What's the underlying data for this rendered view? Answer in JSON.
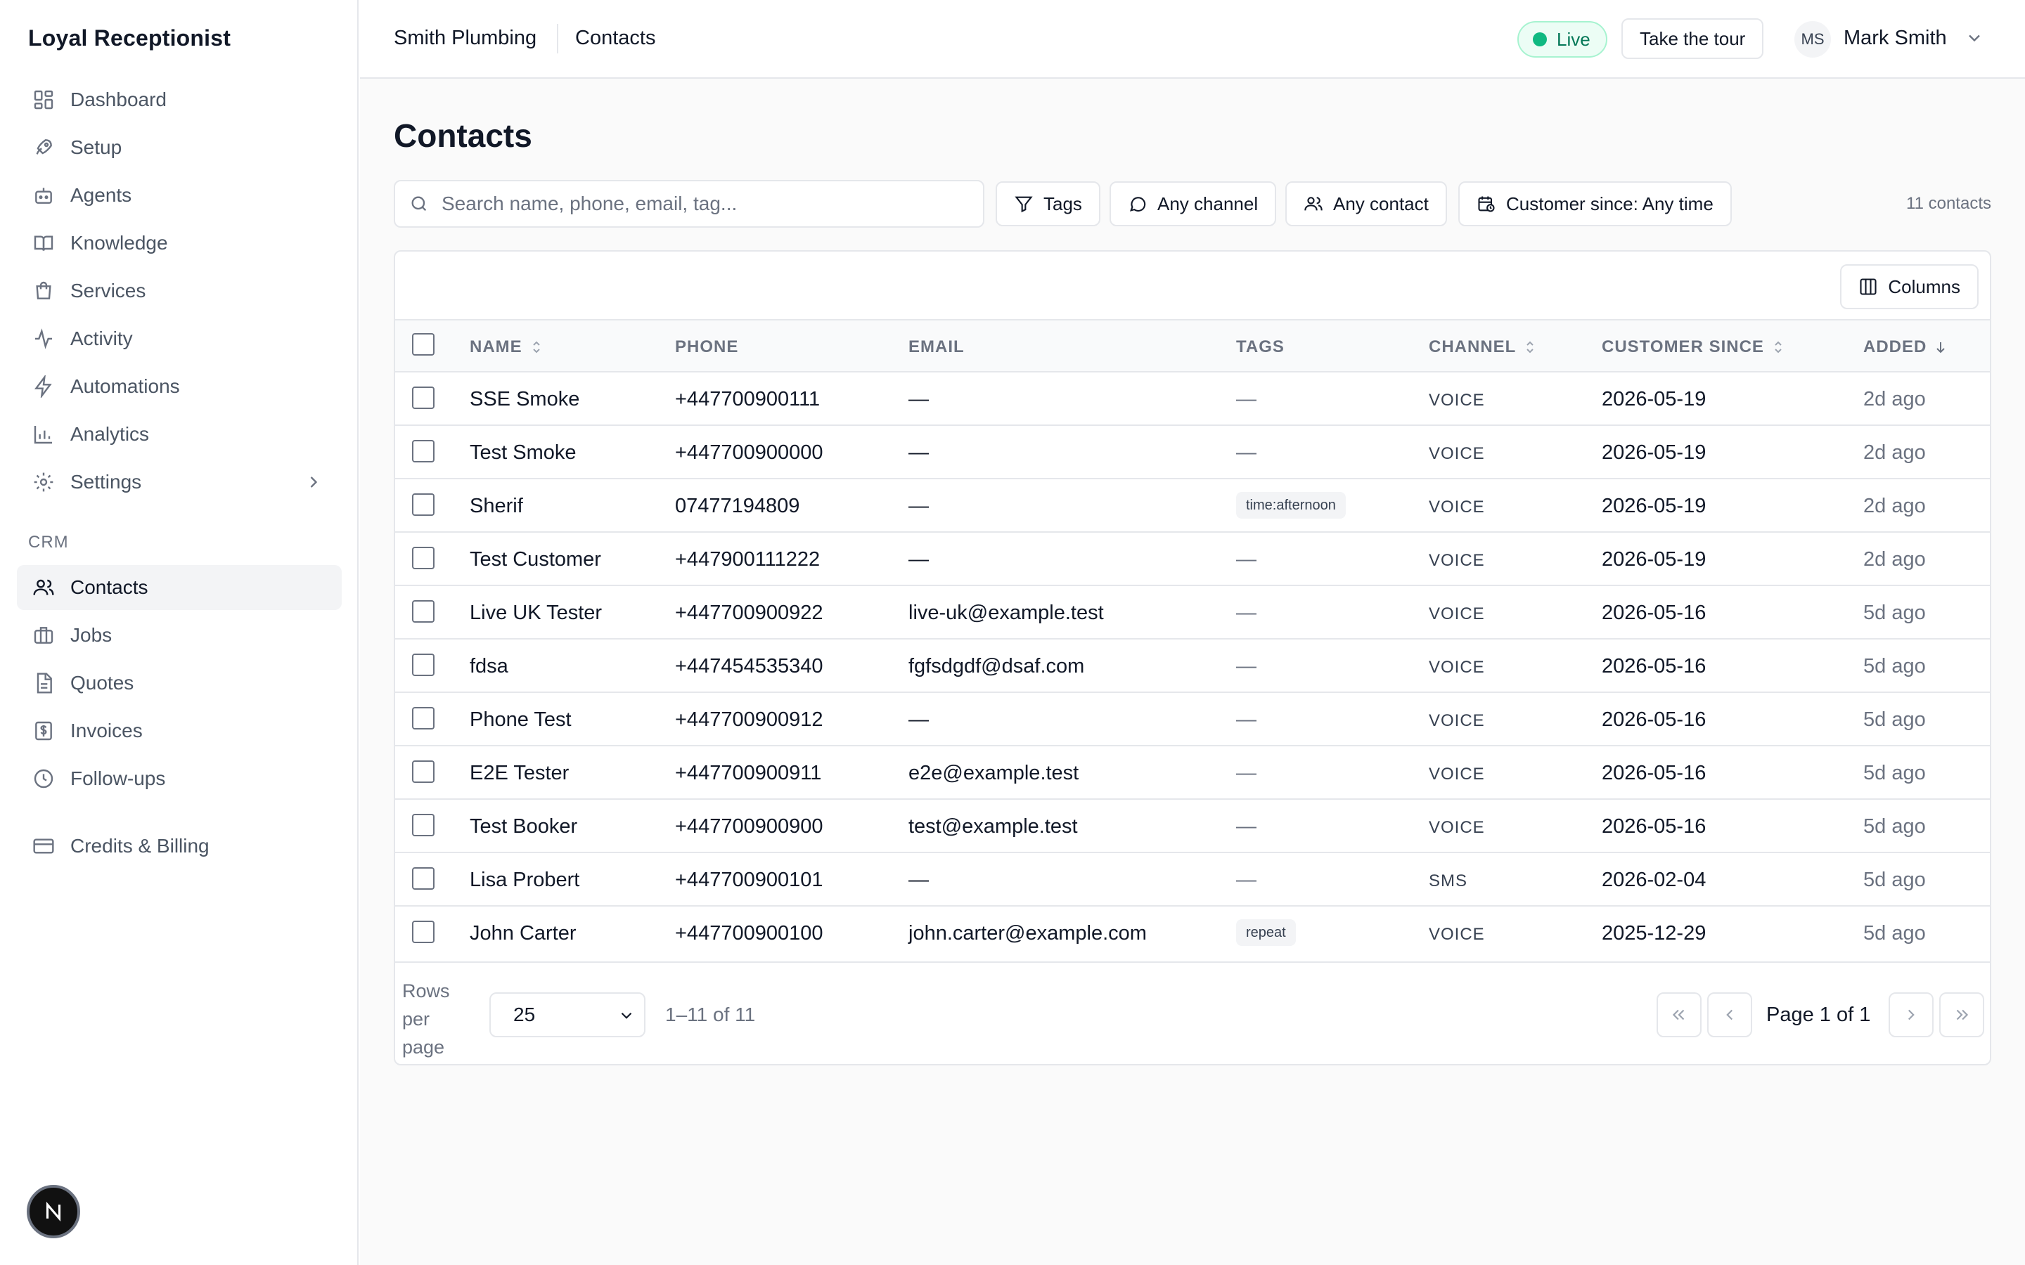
{
  "app": {
    "brand": "Loyal Receptionist"
  },
  "sidebar": {
    "items": [
      {
        "label": "Dashboard",
        "icon": "dashboard-icon"
      },
      {
        "label": "Setup",
        "icon": "rocket-icon"
      },
      {
        "label": "Agents",
        "icon": "bot-icon"
      },
      {
        "label": "Knowledge",
        "icon": "book-icon"
      },
      {
        "label": "Services",
        "icon": "shopping-bag-icon"
      },
      {
        "label": "Activity",
        "icon": "activity-icon"
      },
      {
        "label": "Automations",
        "icon": "lightning-icon"
      },
      {
        "label": "Analytics",
        "icon": "bar-chart-icon"
      },
      {
        "label": "Settings",
        "icon": "gear-icon"
      }
    ],
    "crm_section": "CRM",
    "crm_items": [
      {
        "label": "Contacts",
        "icon": "users-icon",
        "active": true
      },
      {
        "label": "Jobs",
        "icon": "briefcase-icon"
      },
      {
        "label": "Quotes",
        "icon": "file-icon"
      },
      {
        "label": "Invoices",
        "icon": "receipt-icon"
      },
      {
        "label": "Follow-ups",
        "icon": "clock-icon"
      }
    ],
    "billing_item": {
      "label": "Credits & Billing",
      "icon": "credit-card-icon"
    }
  },
  "topbar": {
    "breadcrumb_business": "Smith Plumbing",
    "breadcrumb_page": "Contacts",
    "live_label": "Live",
    "tour_label": "Take the tour",
    "user_initials": "MS",
    "user_name": "Mark Smith"
  },
  "page": {
    "title": "Contacts",
    "search_placeholder": "Search name, phone, email, tag...",
    "filters": {
      "tags": "Tags",
      "channel": "Any channel",
      "contact": "Any contact",
      "customer_since": "Customer since: Any time"
    },
    "count": "11 contacts",
    "columns_label": "Columns"
  },
  "table": {
    "headers": {
      "name": "NAME",
      "phone": "PHONE",
      "email": "EMAIL",
      "tags": "TAGS",
      "channel": "CHANNEL",
      "customer_since": "CUSTOMER SINCE",
      "added": "ADDED"
    },
    "rows": [
      {
        "name": "SSE Smoke",
        "phone": "+447700900111",
        "email": "—",
        "tags": "—",
        "tag_chip": false,
        "channel": "VOICE",
        "since": "2026-05-19",
        "added": "2d ago"
      },
      {
        "name": "Test Smoke",
        "phone": "+447700900000",
        "email": "—",
        "tags": "—",
        "tag_chip": false,
        "channel": "VOICE",
        "since": "2026-05-19",
        "added": "2d ago"
      },
      {
        "name": "Sherif",
        "phone": "07477194809",
        "email": "—",
        "tags": "time:afternoon",
        "tag_chip": true,
        "channel": "VOICE",
        "since": "2026-05-19",
        "added": "2d ago"
      },
      {
        "name": "Test Customer",
        "phone": "+447900111222",
        "email": "—",
        "tags": "—",
        "tag_chip": false,
        "channel": "VOICE",
        "since": "2026-05-19",
        "added": "2d ago"
      },
      {
        "name": "Live UK Tester",
        "phone": "+447700900922",
        "email": "live-uk@example.test",
        "tags": "—",
        "tag_chip": false,
        "channel": "VOICE",
        "since": "2026-05-16",
        "added": "5d ago"
      },
      {
        "name": "fdsa",
        "phone": "+447454535340",
        "email": "fgfsdgdf@dsaf.com",
        "tags": "—",
        "tag_chip": false,
        "channel": "VOICE",
        "since": "2026-05-16",
        "added": "5d ago"
      },
      {
        "name": "Phone Test",
        "phone": "+447700900912",
        "email": "—",
        "tags": "—",
        "tag_chip": false,
        "channel": "VOICE",
        "since": "2026-05-16",
        "added": "5d ago"
      },
      {
        "name": "E2E Tester",
        "phone": "+447700900911",
        "email": "e2e@example.test",
        "tags": "—",
        "tag_chip": false,
        "channel": "VOICE",
        "since": "2026-05-16",
        "added": "5d ago"
      },
      {
        "name": "Test Booker",
        "phone": "+447700900900",
        "email": "test@example.test",
        "tags": "—",
        "tag_chip": false,
        "channel": "VOICE",
        "since": "2026-05-16",
        "added": "5d ago"
      },
      {
        "name": "Lisa Probert",
        "phone": "+447700900101",
        "email": "—",
        "tags": "—",
        "tag_chip": false,
        "channel": "SMS",
        "since": "2026-02-04",
        "added": "5d ago"
      },
      {
        "name": "John Carter",
        "phone": "+447700900100",
        "email": "john.carter@example.com",
        "tags": "repeat",
        "tag_chip": true,
        "channel": "VOICE",
        "since": "2025-12-29",
        "added": "5d ago"
      }
    ]
  },
  "footer": {
    "rows_per_page_label": "Rows per page",
    "rows_per_page_value": "25",
    "range": "1–11 of 11",
    "page_label": "Page 1 of 1"
  },
  "colors": {
    "live_green": "#10b981",
    "text_primary": "#111827",
    "text_muted": "#6b7280",
    "border": "#e5e7eb"
  }
}
